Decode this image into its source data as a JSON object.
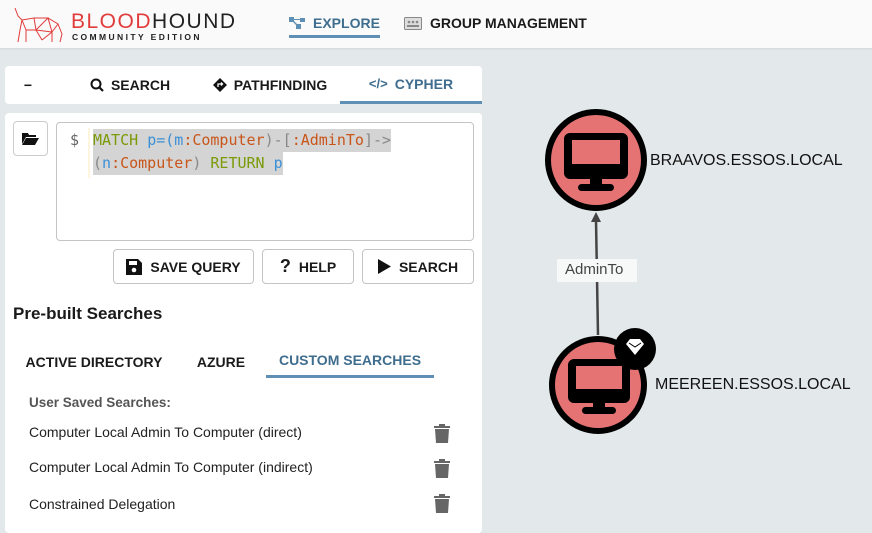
{
  "header": {
    "brand_part1": "BLOOD",
    "brand_part2": "HOUND",
    "brand_sub": "COMMUNITY EDITION",
    "nav": [
      {
        "label": "EXPLORE",
        "icon": "graph-icon",
        "active": true
      },
      {
        "label": "GROUP MANAGEMENT",
        "icon": "group-card-icon",
        "active": false
      }
    ]
  },
  "explore_tabs": {
    "collapse": "−",
    "items": [
      {
        "label": "SEARCH",
        "icon": "search-icon"
      },
      {
        "label": "PATHFINDING",
        "icon": "pathfinding-icon"
      },
      {
        "label": "CYPHER",
        "icon": "code-icon",
        "active": true
      }
    ]
  },
  "cypher": {
    "prompt": "$",
    "query": "MATCH p=(m:Computer)-[:AdminTo]->(n:Computer) RETURN p",
    "buttons": {
      "save": "SAVE QUERY",
      "help": "HELP",
      "search": "SEARCH"
    }
  },
  "prebuilt": {
    "title": "Pre-built Searches",
    "tabs": [
      "ACTIVE DIRECTORY",
      "AZURE",
      "CUSTOM SEARCHES"
    ],
    "active_tab": "CUSTOM SEARCHES",
    "section_label": "User Saved Searches:",
    "items": [
      "Computer Local Admin To Computer (direct)",
      "Computer Local Admin To Computer (indirect)",
      "Constrained Delegation"
    ]
  },
  "graph": {
    "nodes": [
      {
        "label": "BRAAVOS.ESSOS.LOCAL",
        "type": "Computer"
      },
      {
        "label": "MEEREEN.ESSOS.LOCAL",
        "type": "Computer",
        "badge": "gem-icon"
      }
    ],
    "edges": [
      {
        "label": "AdminTo",
        "from": "MEEREEN.ESSOS.LOCAL",
        "to": "BRAAVOS.ESSOS.LOCAL"
      }
    ],
    "node_color": "#e57373"
  },
  "colors": {
    "accent": "#5f8fb4",
    "brand_red": "#e23b3b"
  }
}
